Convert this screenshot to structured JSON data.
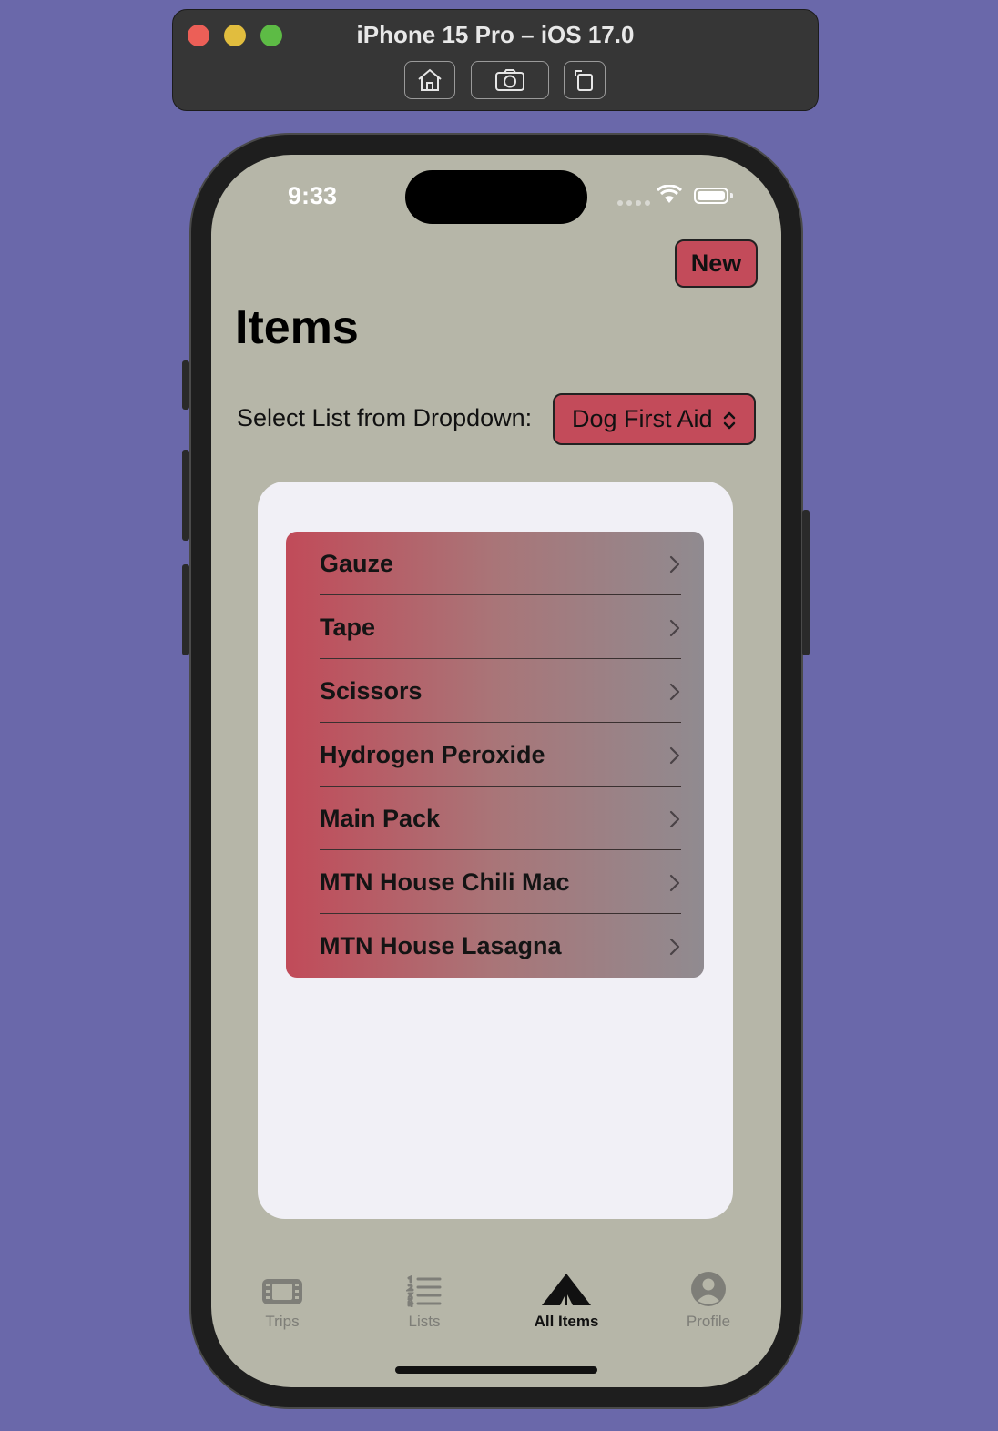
{
  "simulator": {
    "title": "iPhone 15 Pro – iOS 17.0",
    "buttons": [
      "home-icon",
      "screenshot-icon",
      "rotate-icon"
    ]
  },
  "status_bar": {
    "time": "9:33"
  },
  "nav": {
    "new_label": "New"
  },
  "page": {
    "title": "Items",
    "select_label": "Select List from Dropdown:",
    "selected_list": "Dog First Aid"
  },
  "items": [
    {
      "label": "Gauze"
    },
    {
      "label": "Tape"
    },
    {
      "label": "Scissors"
    },
    {
      "label": "Hydrogen Peroxide"
    },
    {
      "label": "Main Pack"
    },
    {
      "label": "MTN House Chili Mac"
    },
    {
      "label": "MTN House Lasagna"
    }
  ],
  "tabs": [
    {
      "label": "Trips",
      "icon": "film-icon",
      "active": false
    },
    {
      "label": "Lists",
      "icon": "list-icon",
      "active": false
    },
    {
      "label": "All Items",
      "icon": "tent-icon",
      "active": true
    },
    {
      "label": "Profile",
      "icon": "person-circle-icon",
      "active": false
    }
  ],
  "colors": {
    "accent": "#c34b5a",
    "screen_bg": "#b6b6a8",
    "card_bg": "#f1f0f6",
    "desktop_bg": "#6a68aa"
  }
}
